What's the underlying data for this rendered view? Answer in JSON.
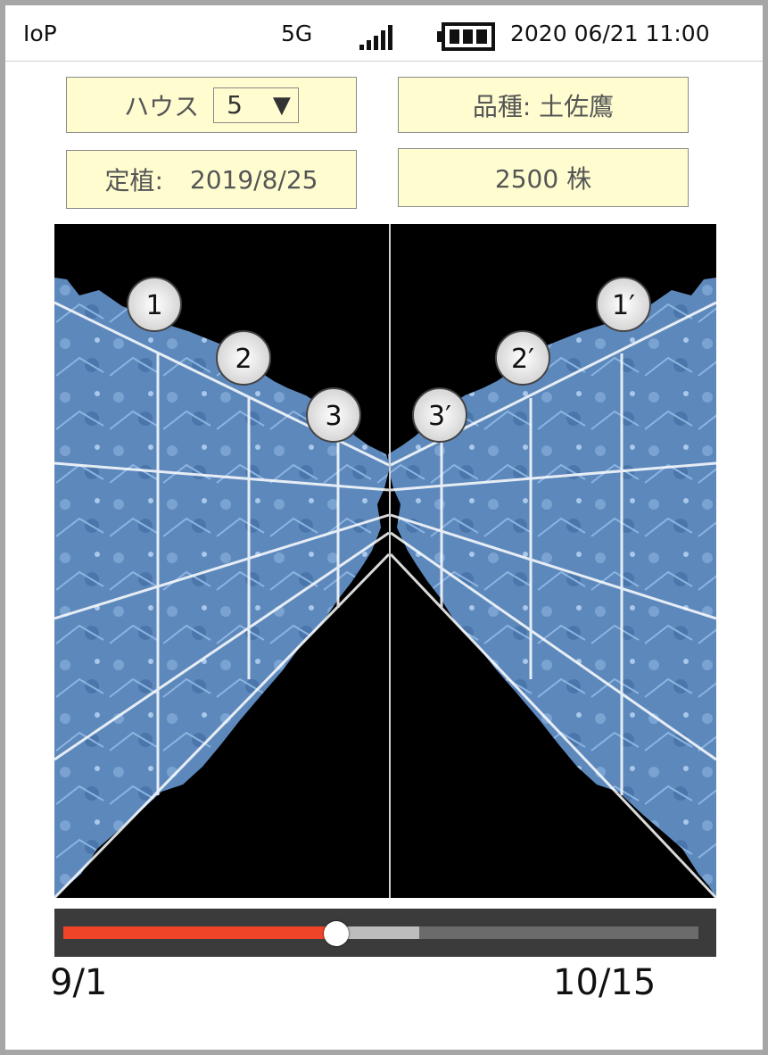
{
  "status_bar": {
    "app_name": "IoP",
    "network": "5G",
    "signal_icon": "signal-bars-icon",
    "battery_icon": "battery-full-icon",
    "datetime": "2020 06/21 11:00"
  },
  "info": {
    "house_label": "ハウス",
    "house_value": "5",
    "variety": "品種: 土佐鷹",
    "planting_label": "定植:",
    "planting_date": "2019/8/25",
    "plant_count": "2500 株"
  },
  "viewer": {
    "left_markers": [
      "1",
      "2",
      "3"
    ],
    "right_markers": [
      "1′",
      "2′",
      "3′"
    ],
    "colors": {
      "plant": "#5d88bc",
      "grid": "#ffffff",
      "background": "#000000"
    }
  },
  "timeline": {
    "start_label": "9/1",
    "end_label": "10/15",
    "progress": 0.43,
    "buffered": 0.56,
    "colors": {
      "progress": "#f04428",
      "buffer": "#bdbdbd",
      "track": "#6b6b6b"
    }
  }
}
